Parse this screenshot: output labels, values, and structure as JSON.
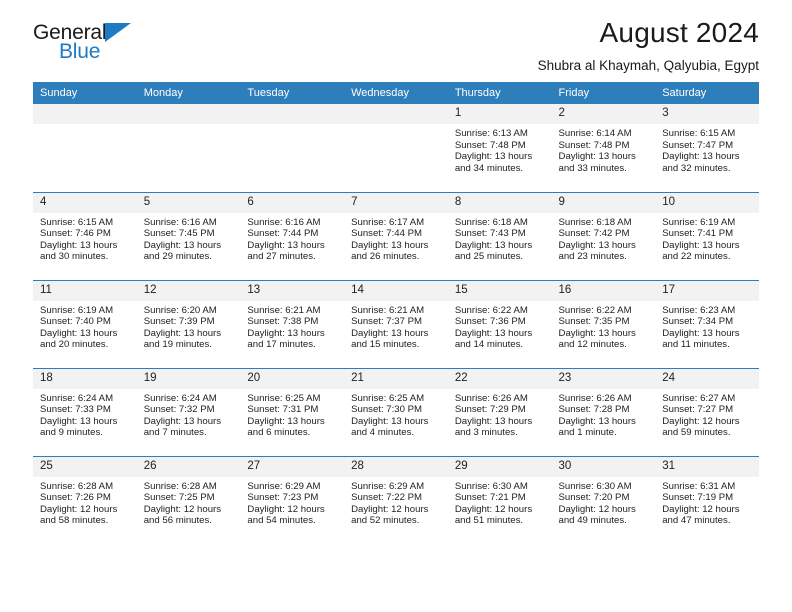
{
  "brand": {
    "name_top": "General",
    "name_bottom": "Blue",
    "accent_color": "#1f7ac4"
  },
  "header": {
    "title": "August 2024",
    "subtitle": "Shubra al Khaymah, Qalyubia, Egypt"
  },
  "theme": {
    "header_bg": "#2e7ebc",
    "daynum_bg": "#f2f2f2",
    "rule": "#2e7ebc"
  },
  "weekdays": [
    "Sunday",
    "Monday",
    "Tuesday",
    "Wednesday",
    "Thursday",
    "Friday",
    "Saturday"
  ],
  "weeks": [
    [
      {
        "day": ""
      },
      {
        "day": ""
      },
      {
        "day": ""
      },
      {
        "day": ""
      },
      {
        "day": "1",
        "sunrise": "Sunrise: 6:13 AM",
        "sunset": "Sunset: 7:48 PM",
        "daylight1": "Daylight: 13 hours",
        "daylight2": "and 34 minutes."
      },
      {
        "day": "2",
        "sunrise": "Sunrise: 6:14 AM",
        "sunset": "Sunset: 7:48 PM",
        "daylight1": "Daylight: 13 hours",
        "daylight2": "and 33 minutes."
      },
      {
        "day": "3",
        "sunrise": "Sunrise: 6:15 AM",
        "sunset": "Sunset: 7:47 PM",
        "daylight1": "Daylight: 13 hours",
        "daylight2": "and 32 minutes."
      }
    ],
    [
      {
        "day": "4",
        "sunrise": "Sunrise: 6:15 AM",
        "sunset": "Sunset: 7:46 PM",
        "daylight1": "Daylight: 13 hours",
        "daylight2": "and 30 minutes."
      },
      {
        "day": "5",
        "sunrise": "Sunrise: 6:16 AM",
        "sunset": "Sunset: 7:45 PM",
        "daylight1": "Daylight: 13 hours",
        "daylight2": "and 29 minutes."
      },
      {
        "day": "6",
        "sunrise": "Sunrise: 6:16 AM",
        "sunset": "Sunset: 7:44 PM",
        "daylight1": "Daylight: 13 hours",
        "daylight2": "and 27 minutes."
      },
      {
        "day": "7",
        "sunrise": "Sunrise: 6:17 AM",
        "sunset": "Sunset: 7:44 PM",
        "daylight1": "Daylight: 13 hours",
        "daylight2": "and 26 minutes."
      },
      {
        "day": "8",
        "sunrise": "Sunrise: 6:18 AM",
        "sunset": "Sunset: 7:43 PM",
        "daylight1": "Daylight: 13 hours",
        "daylight2": "and 25 minutes."
      },
      {
        "day": "9",
        "sunrise": "Sunrise: 6:18 AM",
        "sunset": "Sunset: 7:42 PM",
        "daylight1": "Daylight: 13 hours",
        "daylight2": "and 23 minutes."
      },
      {
        "day": "10",
        "sunrise": "Sunrise: 6:19 AM",
        "sunset": "Sunset: 7:41 PM",
        "daylight1": "Daylight: 13 hours",
        "daylight2": "and 22 minutes."
      }
    ],
    [
      {
        "day": "11",
        "sunrise": "Sunrise: 6:19 AM",
        "sunset": "Sunset: 7:40 PM",
        "daylight1": "Daylight: 13 hours",
        "daylight2": "and 20 minutes."
      },
      {
        "day": "12",
        "sunrise": "Sunrise: 6:20 AM",
        "sunset": "Sunset: 7:39 PM",
        "daylight1": "Daylight: 13 hours",
        "daylight2": "and 19 minutes."
      },
      {
        "day": "13",
        "sunrise": "Sunrise: 6:21 AM",
        "sunset": "Sunset: 7:38 PM",
        "daylight1": "Daylight: 13 hours",
        "daylight2": "and 17 minutes."
      },
      {
        "day": "14",
        "sunrise": "Sunrise: 6:21 AM",
        "sunset": "Sunset: 7:37 PM",
        "daylight1": "Daylight: 13 hours",
        "daylight2": "and 15 minutes."
      },
      {
        "day": "15",
        "sunrise": "Sunrise: 6:22 AM",
        "sunset": "Sunset: 7:36 PM",
        "daylight1": "Daylight: 13 hours",
        "daylight2": "and 14 minutes."
      },
      {
        "day": "16",
        "sunrise": "Sunrise: 6:22 AM",
        "sunset": "Sunset: 7:35 PM",
        "daylight1": "Daylight: 13 hours",
        "daylight2": "and 12 minutes."
      },
      {
        "day": "17",
        "sunrise": "Sunrise: 6:23 AM",
        "sunset": "Sunset: 7:34 PM",
        "daylight1": "Daylight: 13 hours",
        "daylight2": "and 11 minutes."
      }
    ],
    [
      {
        "day": "18",
        "sunrise": "Sunrise: 6:24 AM",
        "sunset": "Sunset: 7:33 PM",
        "daylight1": "Daylight: 13 hours",
        "daylight2": "and 9 minutes."
      },
      {
        "day": "19",
        "sunrise": "Sunrise: 6:24 AM",
        "sunset": "Sunset: 7:32 PM",
        "daylight1": "Daylight: 13 hours",
        "daylight2": "and 7 minutes."
      },
      {
        "day": "20",
        "sunrise": "Sunrise: 6:25 AM",
        "sunset": "Sunset: 7:31 PM",
        "daylight1": "Daylight: 13 hours",
        "daylight2": "and 6 minutes."
      },
      {
        "day": "21",
        "sunrise": "Sunrise: 6:25 AM",
        "sunset": "Sunset: 7:30 PM",
        "daylight1": "Daylight: 13 hours",
        "daylight2": "and 4 minutes."
      },
      {
        "day": "22",
        "sunrise": "Sunrise: 6:26 AM",
        "sunset": "Sunset: 7:29 PM",
        "daylight1": "Daylight: 13 hours",
        "daylight2": "and 3 minutes."
      },
      {
        "day": "23",
        "sunrise": "Sunrise: 6:26 AM",
        "sunset": "Sunset: 7:28 PM",
        "daylight1": "Daylight: 13 hours",
        "daylight2": "and 1 minute."
      },
      {
        "day": "24",
        "sunrise": "Sunrise: 6:27 AM",
        "sunset": "Sunset: 7:27 PM",
        "daylight1": "Daylight: 12 hours",
        "daylight2": "and 59 minutes."
      }
    ],
    [
      {
        "day": "25",
        "sunrise": "Sunrise: 6:28 AM",
        "sunset": "Sunset: 7:26 PM",
        "daylight1": "Daylight: 12 hours",
        "daylight2": "and 58 minutes."
      },
      {
        "day": "26",
        "sunrise": "Sunrise: 6:28 AM",
        "sunset": "Sunset: 7:25 PM",
        "daylight1": "Daylight: 12 hours",
        "daylight2": "and 56 minutes."
      },
      {
        "day": "27",
        "sunrise": "Sunrise: 6:29 AM",
        "sunset": "Sunset: 7:23 PM",
        "daylight1": "Daylight: 12 hours",
        "daylight2": "and 54 minutes."
      },
      {
        "day": "28",
        "sunrise": "Sunrise: 6:29 AM",
        "sunset": "Sunset: 7:22 PM",
        "daylight1": "Daylight: 12 hours",
        "daylight2": "and 52 minutes."
      },
      {
        "day": "29",
        "sunrise": "Sunrise: 6:30 AM",
        "sunset": "Sunset: 7:21 PM",
        "daylight1": "Daylight: 12 hours",
        "daylight2": "and 51 minutes."
      },
      {
        "day": "30",
        "sunrise": "Sunrise: 6:30 AM",
        "sunset": "Sunset: 7:20 PM",
        "daylight1": "Daylight: 12 hours",
        "daylight2": "and 49 minutes."
      },
      {
        "day": "31",
        "sunrise": "Sunrise: 6:31 AM",
        "sunset": "Sunset: 7:19 PM",
        "daylight1": "Daylight: 12 hours",
        "daylight2": "and 47 minutes."
      }
    ]
  ]
}
